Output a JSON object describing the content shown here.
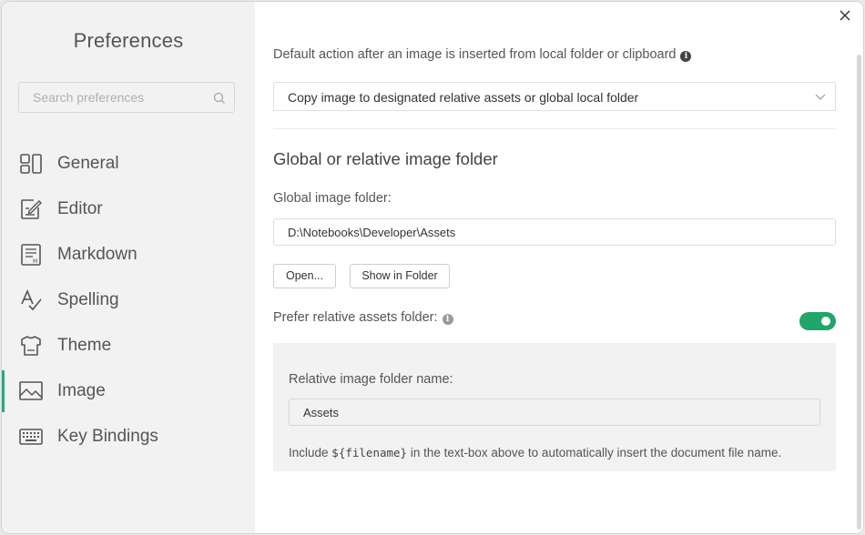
{
  "sidebar": {
    "title": "Preferences",
    "search_placeholder": "Search preferences",
    "items": [
      {
        "label": "General",
        "icon": "general-icon",
        "active": false
      },
      {
        "label": "Editor",
        "icon": "editor-icon",
        "active": false
      },
      {
        "label": "Markdown",
        "icon": "markdown-icon",
        "active": false
      },
      {
        "label": "Spelling",
        "icon": "spelling-icon",
        "active": false
      },
      {
        "label": "Theme",
        "icon": "theme-icon",
        "active": false
      },
      {
        "label": "Image",
        "icon": "image-icon",
        "active": true
      },
      {
        "label": "Key Bindings",
        "icon": "keyboard-icon",
        "active": false
      }
    ],
    "accent_color": "#2ea77a"
  },
  "main": {
    "default_action_label": "Default action after an image is inserted from local folder or clipboard",
    "default_action_value": "Copy image to designated relative assets or global local folder",
    "section_title": "Global or relative image folder",
    "global_folder_label": "Global image folder:",
    "global_folder_value": "D:\\Notebooks\\Developer\\Assets",
    "open_button": "Open...",
    "show_in_folder_button": "Show in Folder",
    "prefer_relative_label": "Prefer relative assets folder:",
    "prefer_relative_enabled": true,
    "toggle_color": "#22a56a",
    "relative_folder_label": "Relative image folder name:",
    "relative_folder_value": "Assets",
    "hint_prefix": "Include ",
    "hint_code": "${filename}",
    "hint_suffix": " in the text-box above to automatically insert the document file name."
  }
}
